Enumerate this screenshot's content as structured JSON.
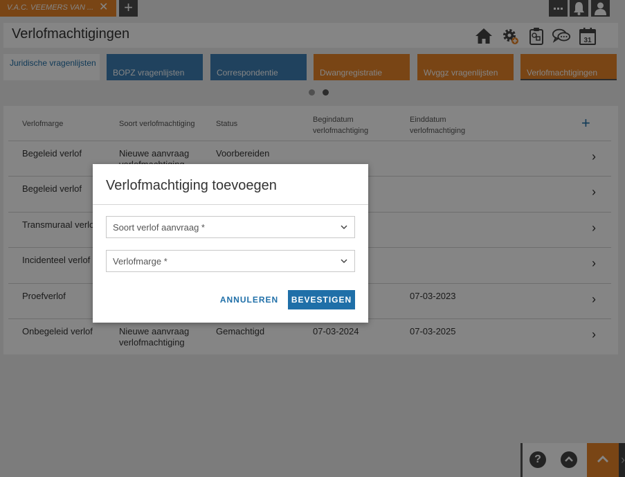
{
  "tabbar": {
    "tab_label": "V.A.C. VEEMERS VAN ...",
    "close_glyph": "✕",
    "add_glyph": "+"
  },
  "header": {
    "title": "Verlofmachtigingen",
    "calendar_day": "31",
    "icons": [
      "home-icon",
      "settings-add-icon",
      "clipboard-icon",
      "chat-icon",
      "calendar-icon"
    ]
  },
  "nav_tiles": [
    {
      "label": "Juridische vragenlijsten"
    },
    {
      "label": "BOPZ vragenlijsten"
    },
    {
      "label": "Correspondentie"
    },
    {
      "label": "Dwangregistratie"
    },
    {
      "label": "Wvggz vragenlijsten"
    },
    {
      "label": "Verlofmachtigingen"
    }
  ],
  "table": {
    "headers": {
      "marge": "Verlofmarge",
      "soort": "Soort verlofmachtiging",
      "status": "Status",
      "begin": "Begindatum verlofmachtiging",
      "eind": "Einddatum verlofmachtiging"
    },
    "add_glyph": "+",
    "rows": [
      {
        "marge": "Begeleid verlof",
        "soort": "Nieuwe aanvraag verlofmachtiging",
        "status": "Voorbereiden",
        "begin": "",
        "eind": ""
      },
      {
        "marge": "Begeleid verlof",
        "soort": "",
        "status": "",
        "begin": "",
        "eind": ""
      },
      {
        "marge": "Transmuraal verlof",
        "soort": "",
        "status": "",
        "begin": "",
        "eind": ""
      },
      {
        "marge": "Incidenteel verlof",
        "soort": "",
        "status": "",
        "begin": "",
        "eind": ""
      },
      {
        "marge": "Proefverlof",
        "soort": "",
        "status": "",
        "begin": "",
        "eind": "07-03-2023"
      },
      {
        "marge": "Onbegeleid verlof",
        "soort": "Nieuwe aanvraag verlofmachtiging",
        "status": "Gemachtigd",
        "begin": "07-03-2024",
        "eind": "07-03-2025"
      }
    ]
  },
  "modal": {
    "title": "Verlofmachtiging toevoegen",
    "field1_placeholder": "Soort verlof aanvraag *",
    "field2_placeholder": "Verlofmarge *",
    "cancel_label": "ANNULEREN",
    "confirm_label": "BEVESTIGEN"
  },
  "help_widget": {
    "question_glyph": "?"
  },
  "colors": {
    "orange": "#e8842a",
    "blue": "#3e7fb4",
    "link_blue": "#1f6fa8",
    "dark": "#4d4d4d"
  }
}
